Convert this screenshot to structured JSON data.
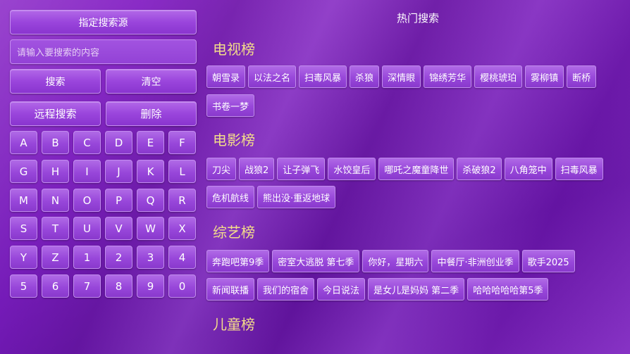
{
  "left": {
    "source_button": "指定搜索源",
    "search_placeholder": "请输入要搜索的内容",
    "search_button": "搜索",
    "clear_button": "清空",
    "remote_search_button": "远程搜索",
    "delete_button": "删除",
    "keys": [
      "A",
      "B",
      "C",
      "D",
      "E",
      "F",
      "G",
      "H",
      "I",
      "J",
      "K",
      "L",
      "M",
      "N",
      "O",
      "P",
      "Q",
      "R",
      "S",
      "T",
      "U",
      "V",
      "W",
      "X",
      "Y",
      "Z",
      "1",
      "2",
      "3",
      "4",
      "5",
      "6",
      "7",
      "8",
      "9",
      "0"
    ]
  },
  "hot": {
    "title": "热门搜索",
    "sections": [
      {
        "title": "电视榜",
        "rows": [
          [
            "朝雪录",
            "以法之名",
            "扫毒风暴",
            "杀狼",
            "深情眼",
            "锦绣芳华",
            "樱桃琥珀",
            "雾柳镇",
            "断桥"
          ],
          [
            "书卷一梦"
          ]
        ]
      },
      {
        "title": "电影榜",
        "rows": [
          [
            "刀尖",
            "战狼2",
            "让子弹飞",
            "水饺皇后",
            "哪吒之魔童降世",
            "杀破狼2",
            "八角笼中",
            "扫毒风暴"
          ],
          [
            "危机航线",
            "熊出没·重返地球"
          ]
        ]
      },
      {
        "title": "综艺榜",
        "rows": [
          [
            "奔跑吧第9季",
            "密室大逃脱 第七季",
            "你好，星期六",
            "中餐厅·非洲创业季",
            "歌手2025"
          ],
          [
            "新闻联播",
            "我们的宿舍",
            "今日说法",
            "是女儿是妈妈 第二季",
            "哈哈哈哈哈第5季"
          ]
        ]
      },
      {
        "title": "儿童榜",
        "rows": []
      }
    ]
  }
}
